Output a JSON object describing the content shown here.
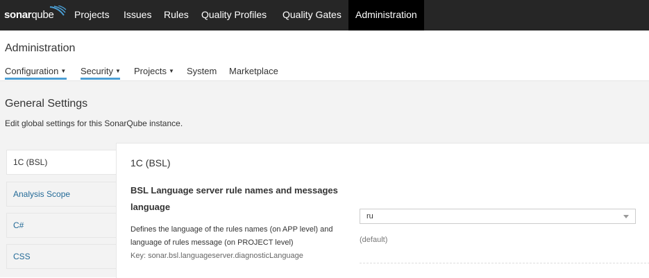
{
  "navbar": {
    "logo": {
      "prefix": "sonar",
      "suffix": "qube"
    },
    "items": [
      "Projects",
      "Issues",
      "Rules",
      "Quality Profiles",
      "Quality Gates",
      "Administration"
    ],
    "active_item": "Administration",
    "background": "#262626"
  },
  "context": {
    "title": "Administration",
    "menu": [
      {
        "label": "Configuration",
        "has_dropdown": true,
        "selected": true
      },
      {
        "label": "Security",
        "has_dropdown": true,
        "selected": true
      },
      {
        "label": "Projects",
        "has_dropdown": true,
        "selected": false
      },
      {
        "label": "System",
        "has_dropdown": false,
        "selected": false
      },
      {
        "label": "Marketplace",
        "has_dropdown": false,
        "selected": false
      }
    ],
    "accent": "#4b9fd5"
  },
  "page": {
    "title": "General Settings",
    "description": "Edit global settings for this SonarQube instance."
  },
  "sidebar": {
    "items": [
      {
        "label": "1C (BSL)",
        "active": true
      },
      {
        "label": "Analysis Scope",
        "active": false
      },
      {
        "label": "C#",
        "active": false
      },
      {
        "label": "CSS",
        "active": false
      }
    ],
    "link_color": "#236a97"
  },
  "panel": {
    "title": "1C (BSL)",
    "setting": {
      "name": "BSL Language server rule names and messages language",
      "description": "Defines the language of the rules names (on APP level) and language of rules message (on PROJECT level)",
      "key": "Key: sonar.bsl.languageserver.diagnosticLanguage",
      "value": "ru",
      "default_label": "(default)"
    }
  }
}
